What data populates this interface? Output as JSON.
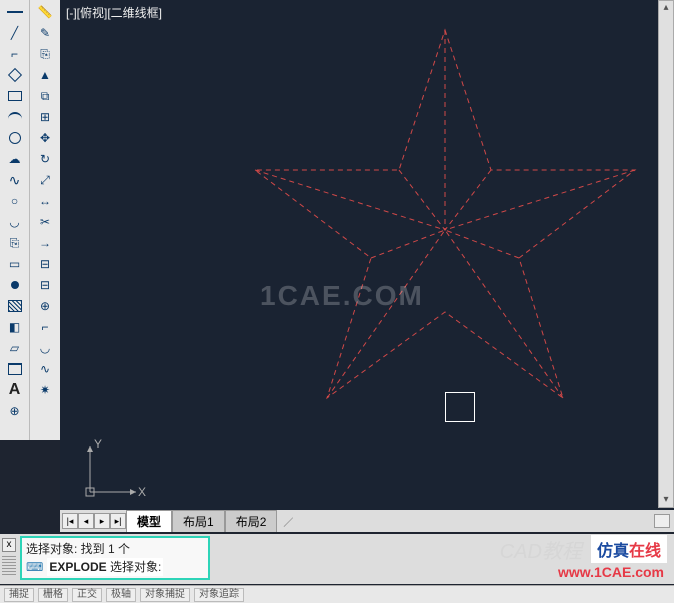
{
  "view_label": "[-][俯视][二维线框]",
  "centermark": "1CAE.COM",
  "ucs": {
    "x": "X",
    "y": "Y"
  },
  "tabs": {
    "nav": [
      "|◂",
      "◂",
      "▸",
      "▸|"
    ],
    "items": [
      "模型",
      "布局1",
      "布局2"
    ],
    "trailing": "／"
  },
  "command_panel": {
    "close": "x",
    "line1": "选择对象: 找到 1 个",
    "icon_glyph": "⌨",
    "line2_cmd": "EXPLODE",
    "line2_prompt": "选择对象:"
  },
  "status": {
    "segments": [
      "捕捉",
      "栅格",
      "正交",
      "极轴",
      "对象捕捉",
      "对象追踪"
    ]
  },
  "watermarks": {
    "cad": "CAD教程",
    "sim": "仿真",
    "online": "在线",
    "url": "www.1CAE.com"
  },
  "tools_col1": [
    {
      "n": "line-tool",
      "t": "line"
    },
    {
      "n": "construction-line-tool",
      "t": "glyph",
      "g": "╱"
    },
    {
      "n": "polyline-tool",
      "t": "glyph",
      "g": "⌐"
    },
    {
      "n": "polygon-tool",
      "t": "poly"
    },
    {
      "n": "rectangle-tool",
      "t": "rect"
    },
    {
      "n": "arc-tool",
      "t": "arc"
    },
    {
      "n": "circle-tool",
      "t": "circle"
    },
    {
      "n": "revcloud-tool",
      "t": "glyph",
      "g": "☁"
    },
    {
      "n": "spline-tool",
      "t": "spline",
      "g": "∿"
    },
    {
      "n": "ellipse-tool",
      "t": "glyph",
      "g": "○"
    },
    {
      "n": "ellipse-arc-tool",
      "t": "glyph",
      "g": "◡"
    },
    {
      "n": "insert-block-tool",
      "t": "glyph",
      "g": "⎘"
    },
    {
      "n": "make-block-tool",
      "t": "glyph",
      "g": "▭"
    },
    {
      "n": "point-tool",
      "t": "dot"
    },
    {
      "n": "hatch-tool",
      "t": "hatch"
    },
    {
      "n": "gradient-tool",
      "t": "glyph",
      "g": "◧"
    },
    {
      "n": "region-tool",
      "t": "glyph",
      "g": "▱"
    },
    {
      "n": "table-tool",
      "t": "table"
    },
    {
      "n": "mtext-tool",
      "t": "a",
      "g": "A"
    },
    {
      "n": "addselected-tool",
      "t": "glyph",
      "g": "⊕"
    }
  ],
  "tools_col2": [
    {
      "n": "measure-tool",
      "t": "glyph",
      "g": "📏"
    },
    {
      "n": "erase-tool",
      "t": "glyph",
      "g": "✎"
    },
    {
      "n": "copy-tool",
      "t": "glyph",
      "g": "⎘"
    },
    {
      "n": "mirror-tool",
      "t": "glyph",
      "g": "▲"
    },
    {
      "n": "offset-tool",
      "t": "glyph",
      "g": "⧉"
    },
    {
      "n": "array-tool",
      "t": "glyph",
      "g": "⊞"
    },
    {
      "n": "move-tool",
      "t": "glyph",
      "g": "✥"
    },
    {
      "n": "rotate-tool",
      "t": "glyph",
      "g": "↻"
    },
    {
      "n": "scale-tool",
      "t": "glyph",
      "g": "⤢"
    },
    {
      "n": "stretch-tool",
      "t": "glyph",
      "g": "↔"
    },
    {
      "n": "trim-tool",
      "t": "glyph",
      "g": "✂"
    },
    {
      "n": "extend-tool",
      "t": "glyph",
      "g": "→"
    },
    {
      "n": "break-at-point-tool",
      "t": "glyph",
      "g": "⊟"
    },
    {
      "n": "break-tool",
      "t": "glyph",
      "g": "⊟"
    },
    {
      "n": "join-tool",
      "t": "glyph",
      "g": "⊕"
    },
    {
      "n": "chamfer-tool",
      "t": "glyph",
      "g": "⌐"
    },
    {
      "n": "fillet-tool",
      "t": "glyph",
      "g": "◡"
    },
    {
      "n": "blend-tool",
      "t": "glyph",
      "g": "∿"
    },
    {
      "n": "explode-tool",
      "t": "glyph",
      "g": "✷"
    }
  ],
  "chart_data": null
}
